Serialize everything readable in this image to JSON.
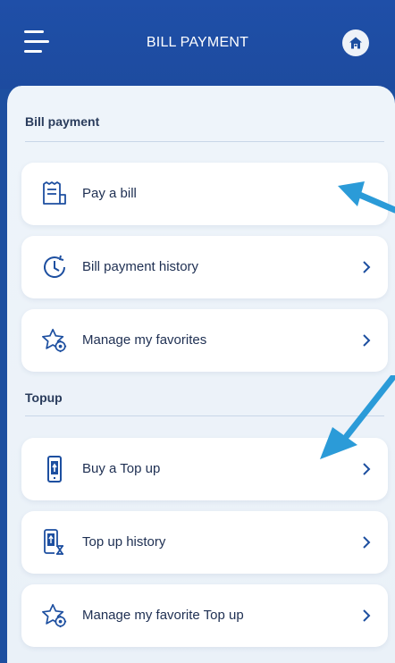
{
  "header": {
    "title": "BILL PAYMENT",
    "menu_icon": "hamburger-menu-icon",
    "home_icon": "home-icon"
  },
  "sections": [
    {
      "title": "Bill payment",
      "items": [
        {
          "label": "Pay a bill",
          "icon": "receipt-icon",
          "chevron": false
        },
        {
          "label": "Bill payment history",
          "icon": "history-clock-icon",
          "chevron": true
        },
        {
          "label": "Manage my favorites",
          "icon": "star-gear-icon",
          "chevron": true
        }
      ]
    },
    {
      "title": "Topup",
      "items": [
        {
          "label": "Buy a Top up",
          "icon": "phone-topup-icon",
          "chevron": true
        },
        {
          "label": "Top up history",
          "icon": "phone-hourglass-icon",
          "chevron": true
        },
        {
          "label": "Manage my favorite Top up",
          "icon": "star-gear-icon",
          "chevron": true
        }
      ]
    }
  ],
  "colors": {
    "brand": "#1d4fa0",
    "annotation_arrow": "#2b9bd8",
    "text": "#1e2f52"
  }
}
